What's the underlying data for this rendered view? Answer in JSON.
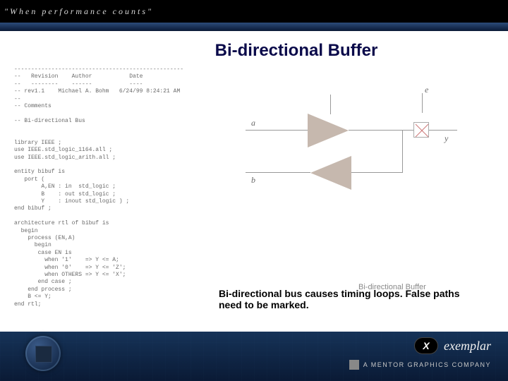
{
  "header": {
    "tagline": "\"When performance counts\""
  },
  "slide": {
    "title": "Bi-directional Buffer",
    "code": "--------------------------------------------------\n--   Revision    Author           Date\n--   --------    ------           ----\n-- rev1.1    Michael A. Bohm   6/24/99 8:24:21 AM\n--\n-- Comments\n\n-- Bi-directional Bus\n\n\nlibrary IEEE ;\nuse IEEE.std_logic_1164.all ;\nuse IEEE.std_logic_arith.all ;\n\nentity bibuf is\n   port (\n        A,EN : in  std_logic ;\n        B    : out std_logic ;\n        Y    : inout std_logic ) ;\nend bibuf ;\n\narchitecture rtl of bibuf is\n  begin\n    process (EN,A)\n      begin\n       case EN is\n         when '1'    => Y <= A;\n         when '0'    => Y <= 'Z';\n         when OTHERS => Y <= 'X';\n       end case ;\n    end process ;\n    B <= Y;\nend rtl;",
    "labels": {
      "a": "a",
      "b": "b",
      "e": "e",
      "y": "y"
    },
    "caption": "Bi-directional Buffer",
    "note": "Bi-directional bus causes timing loops. False paths need to be marked."
  },
  "footer": {
    "brand": "exemplar",
    "brand_mark": "X",
    "company": "A MENTOR GRAPHICS COMPANY"
  }
}
